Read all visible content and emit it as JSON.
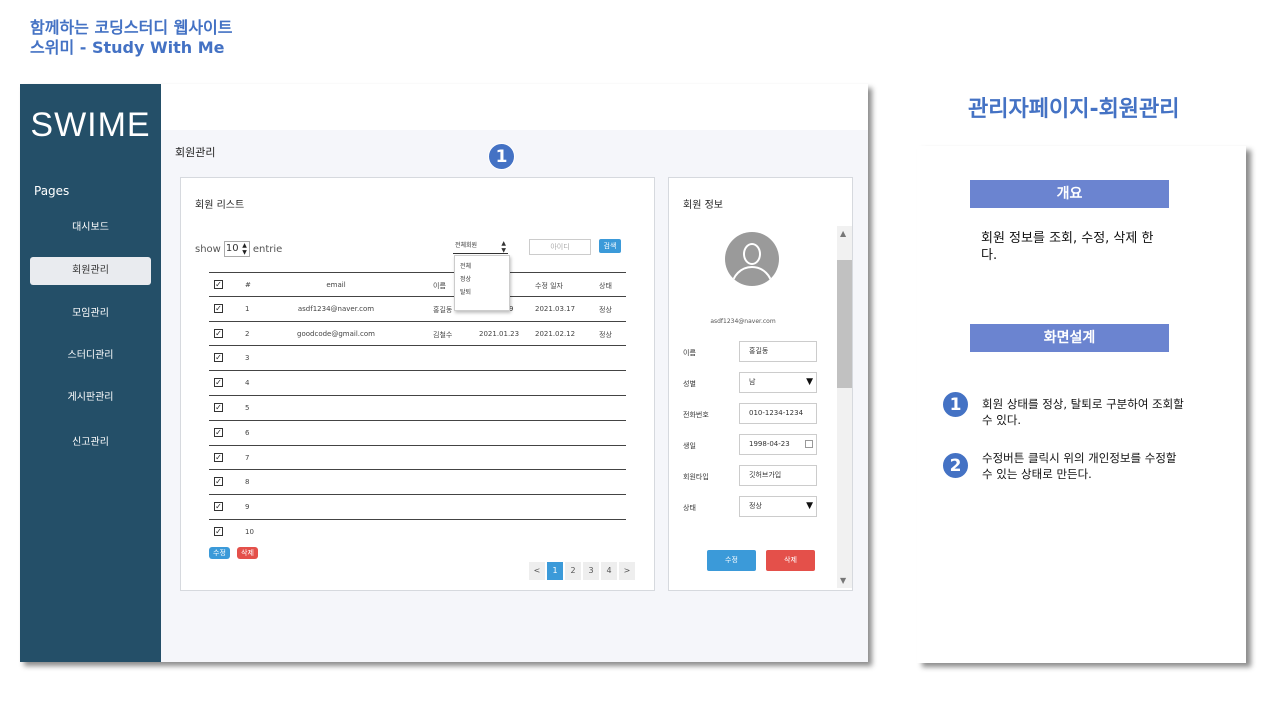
{
  "slide": {
    "title_line1": "함께하는 코딩스터디 웹사이트",
    "title_line2": "스위미 - Study With Me"
  },
  "sidebar": {
    "logo": "SWIME",
    "section_label": "Pages",
    "items": [
      {
        "label": "대시보드",
        "active": false
      },
      {
        "label": "회원관리",
        "active": true
      },
      {
        "label": "모임관리",
        "active": false
      },
      {
        "label": "스터디관리",
        "active": false
      },
      {
        "label": "게시판관리",
        "active": false
      },
      {
        "label": "신고관리",
        "active": false
      }
    ]
  },
  "main": {
    "page_heading": "회원관리",
    "list_panel": {
      "title": "회원 리스트",
      "show_prefix": "show",
      "show_value": "10",
      "show_suffix": "entrie",
      "filter_value": "전체회원",
      "filter_options": [
        "전체",
        "정상",
        "탈퇴"
      ],
      "search_placeholder": "아이디",
      "search_button": "검색",
      "table_headers": {
        "no": "#",
        "email": "email",
        "name": "이름",
        "join": "",
        "modified": "수정 일자",
        "state": "상태"
      },
      "rows": [
        {
          "no": "1",
          "email": "asdf1234@naver.com",
          "name": "홍길동",
          "join": "9",
          "modified": "2021.03.17",
          "state": "정상"
        },
        {
          "no": "2",
          "email": "goodcode@gmail.com",
          "name": "김철수",
          "join": "2021.01.23",
          "modified": "2021.02.12",
          "state": "정상"
        },
        {
          "no": "3"
        },
        {
          "no": "4"
        },
        {
          "no": "5"
        },
        {
          "no": "6"
        },
        {
          "no": "7"
        },
        {
          "no": "8"
        },
        {
          "no": "9"
        },
        {
          "no": "10"
        }
      ],
      "edit_button": "수정",
      "delete_button": "삭제",
      "pagination": {
        "prev": "<",
        "pages": [
          "1",
          "2",
          "3",
          "4"
        ],
        "current": "1",
        "next": ">"
      }
    },
    "info_panel": {
      "title": "회원 정보",
      "email": "asdf1234@naver.com",
      "fields": [
        {
          "label": "이름",
          "value": "홍길동",
          "type": "text"
        },
        {
          "label": "성별",
          "value": "남",
          "type": "select"
        },
        {
          "label": "전화번호",
          "value": "010-1234-1234",
          "type": "text"
        },
        {
          "label": "생일",
          "value": "1998-04-23",
          "type": "date"
        },
        {
          "label": "회원타입",
          "value": "깃허브가입",
          "type": "text"
        },
        {
          "label": "상태",
          "value": "정상",
          "type": "select"
        }
      ],
      "edit_button": "수정",
      "delete_button": "삭제"
    }
  },
  "description": {
    "title": "관리자페이지-회원관리",
    "overview_heading": "개요",
    "overview_text": "회원 정보를 조회, 수정, 삭제 한다.",
    "design_heading": "화면설계",
    "items": [
      {
        "number": "1",
        "text": "회원 상태를 정상, 탈퇴로 구분하여 조회할 수 있다."
      },
      {
        "number": "2",
        "text": "수정버튼 클릭시 위의 개인정보를 수정할 수 있는 상태로 만든다."
      }
    ]
  },
  "colors": {
    "sidebar_bg": "#244f68",
    "accent": "#4472c4",
    "section_bar": "#6b84d0",
    "primary_button": "#3b9ad9",
    "danger_button": "#e4504a"
  }
}
